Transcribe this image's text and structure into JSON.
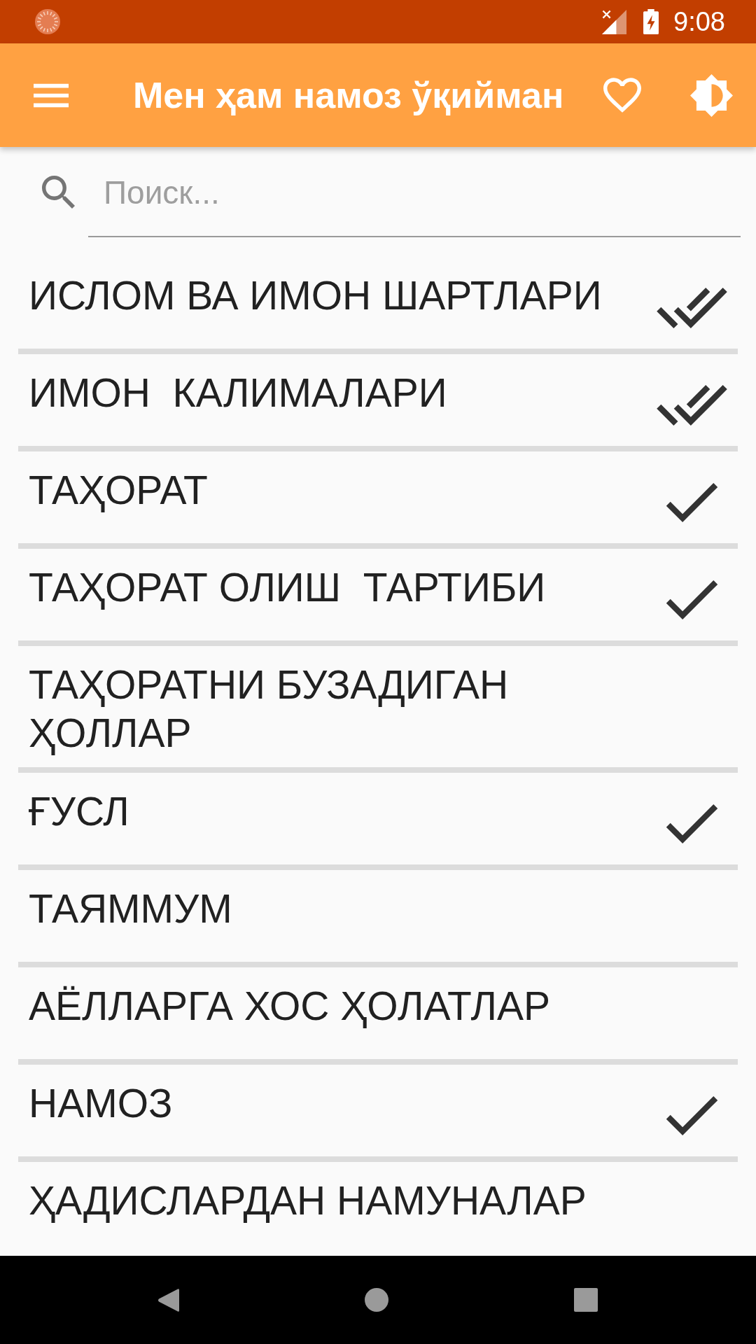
{
  "status_bar": {
    "time": "9:08"
  },
  "app_bar": {
    "title": "Мен ҳам намоз ўқийман"
  },
  "search": {
    "placeholder": "Поиск..."
  },
  "items": [
    {
      "title": "ИСЛОМ ВА ИМОН ШАРТЛАРИ",
      "checked": true,
      "double_checked": true
    },
    {
      "title": "ИМОН  КАЛИМАЛАРИ",
      "checked": true,
      "double_checked": true
    },
    {
      "title": "ТАҲОРАТ",
      "checked": true,
      "double_checked": false
    },
    {
      "title": "ТАҲОРАТ ОЛИШ  ТАРТИБИ",
      "checked": true,
      "double_checked": false
    },
    {
      "title": "ТАҲОРАТНИ БУЗАДИГАН ҲОЛЛАР",
      "checked": false,
      "double_checked": false
    },
    {
      "title": "ҒУСЛ",
      "checked": true,
      "double_checked": false
    },
    {
      "title": "ТАЯММУМ",
      "checked": false,
      "double_checked": false
    },
    {
      "title": "АЁЛЛАРГА ХОС ҲОЛАТЛАР",
      "checked": false,
      "double_checked": false
    },
    {
      "title": "НАМОЗ",
      "checked": true,
      "double_checked": false
    },
    {
      "title": "ҲАДИСЛАРДАН НАМУНАЛАР",
      "checked": false,
      "double_checked": false
    }
  ]
}
